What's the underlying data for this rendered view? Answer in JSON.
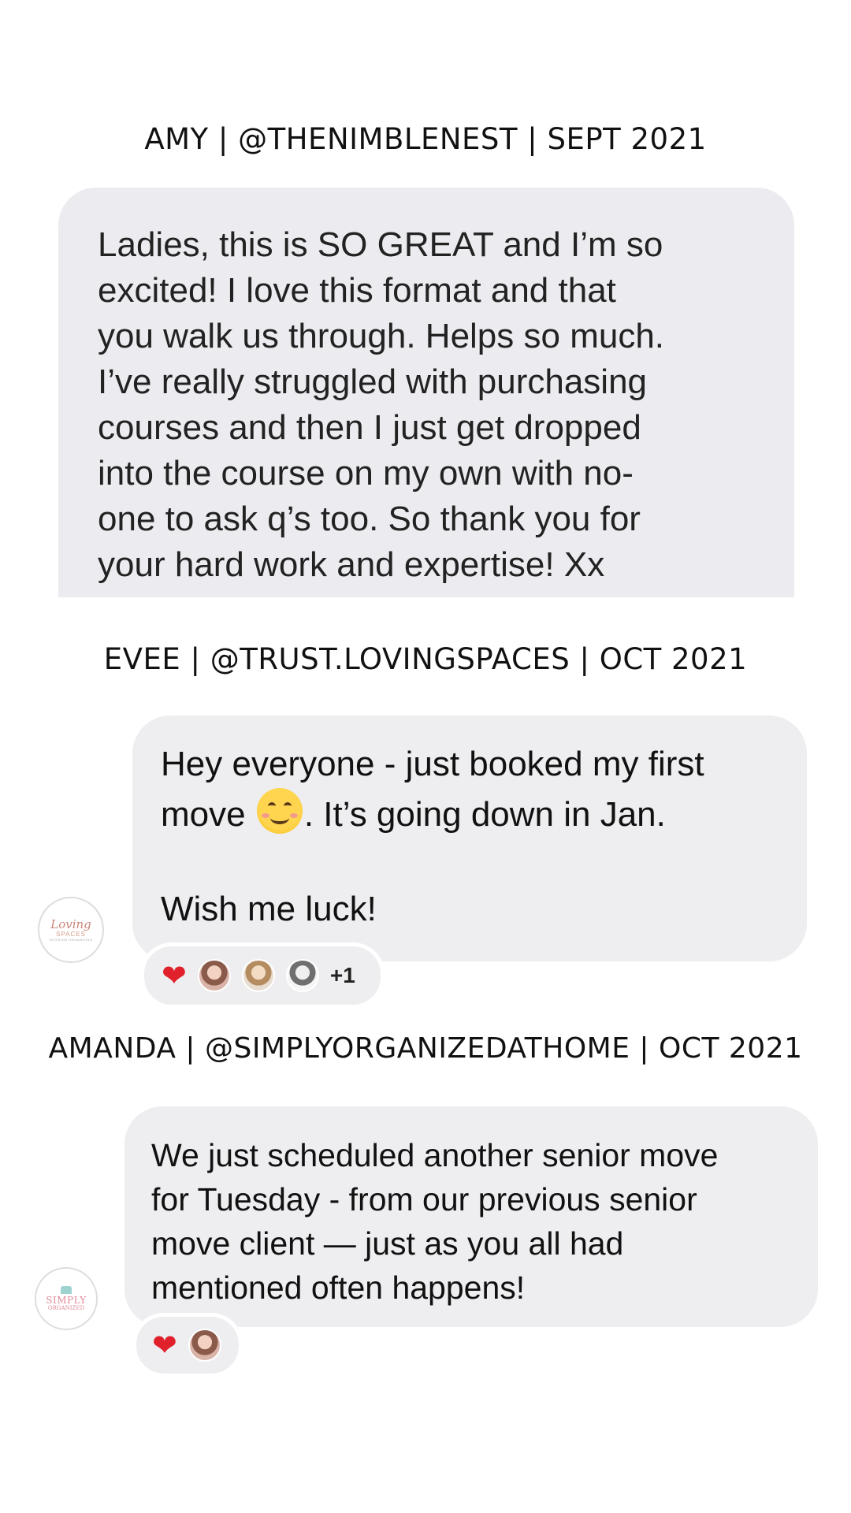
{
  "testimonials": [
    {
      "heading": "AMY  | @THENIMBLENEST | SEPT 2021",
      "message": "Ladies, this is SO GREAT and I’m so\nexcited!  I love this format and that\nyou walk us through.  Helps so much.\nI’ve really struggled with purchasing\ncourses and then I just get dropped\ninto the course on my own with no-\none to ask q’s too.  So thank you for\nyour hard work and expertise!  Xx"
    },
    {
      "heading": "EVEE  | @TRUST.LOVINGSPACES | OCT 2021",
      "message_line1": "Hey everyone - just booked my first",
      "message_line2_pre": "move ",
      "message_line2_post": ". It’s going down in Jan.",
      "message_line3": "Wish me luck!",
      "emoji": "smiling-face-emoji",
      "avatar": {
        "line1": "Loving",
        "line2": "SPACES",
        "line3": "INTERIOR ORGANIZING"
      },
      "reactions": {
        "emoji": "❤",
        "extra_count": "+1"
      }
    },
    {
      "heading": "AMANDA | @SIMPLYORGANIZEDATHOME | OCT 2021",
      "message": "We just scheduled another senior move\nfor Tuesday - from our previous senior\nmove client — just as you all had\nmentioned often happens!",
      "avatar": {
        "line1": "SIMPLY",
        "line2": "ORGANIZED"
      },
      "reactions": {
        "emoji": "❤"
      }
    }
  ],
  "colors": {
    "bubble": "#eeeef0",
    "heart": "#e0202a",
    "text": "#111111"
  }
}
